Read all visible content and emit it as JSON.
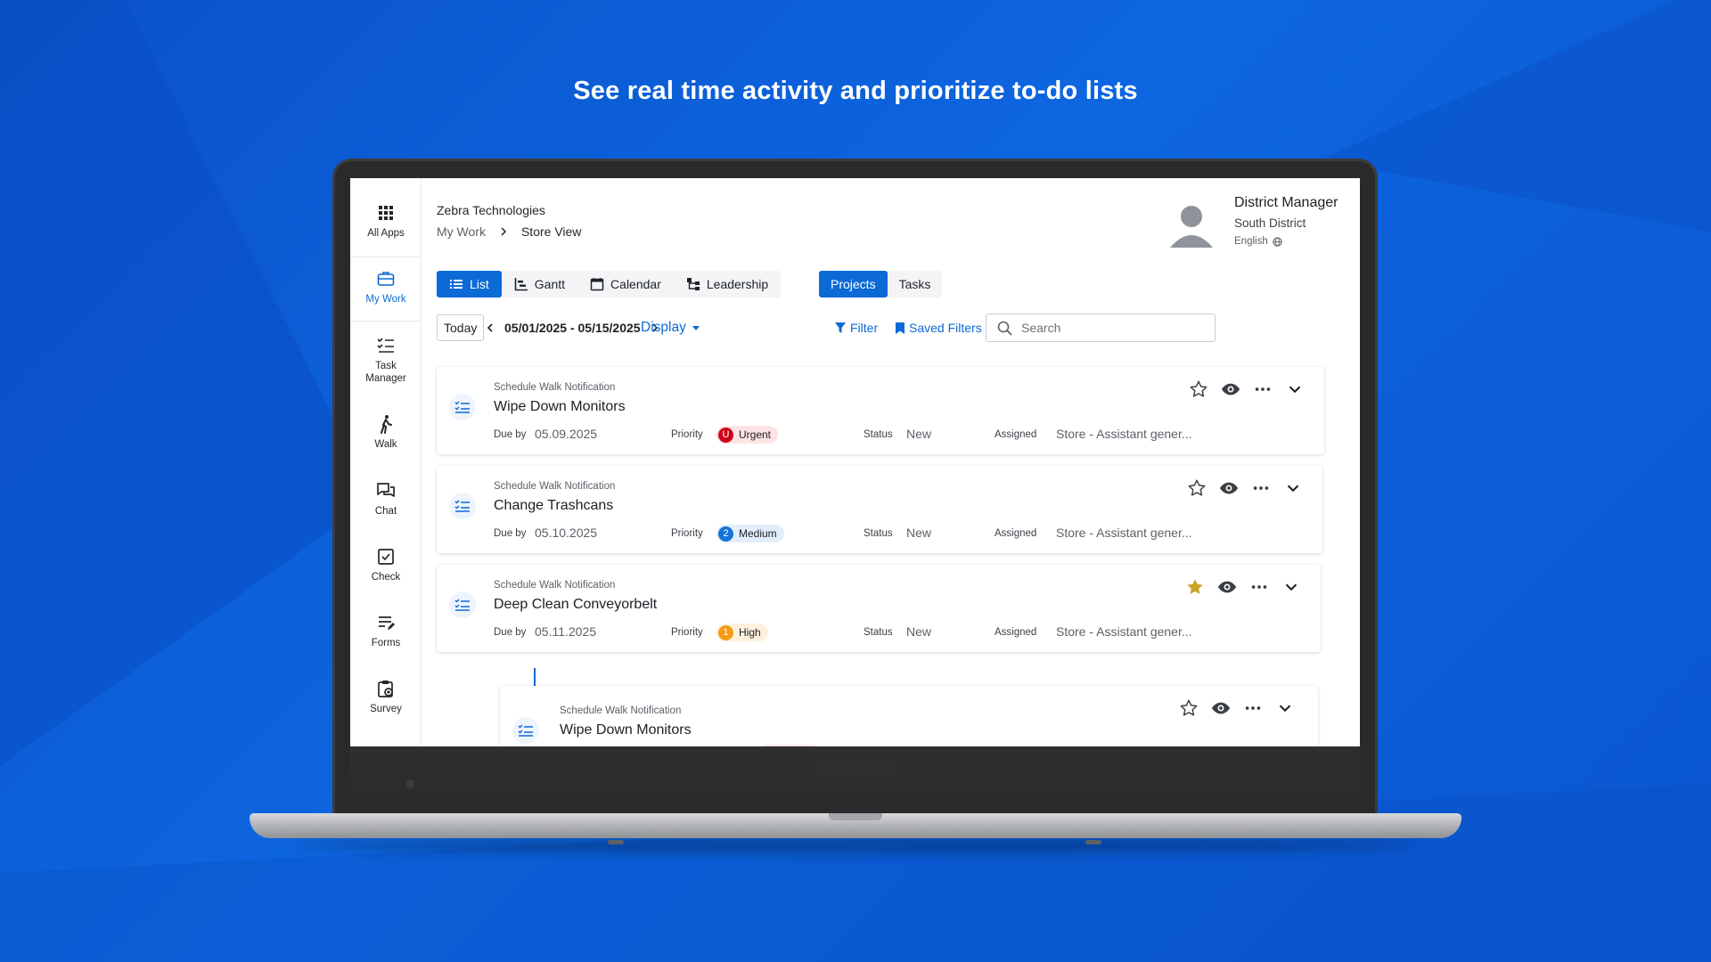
{
  "headline": "See real time activity and prioritize to-do lists",
  "colors": {
    "accent": "#0b6ad6",
    "urgent": "#d0021b",
    "medium": "#1673d8",
    "high": "#f39c12",
    "star_active": "#c9a227"
  },
  "sidebar": {
    "items": [
      {
        "label": "All Apps",
        "icon": "apps-grid-icon"
      },
      {
        "label": "My Work",
        "icon": "briefcase-icon",
        "active": true
      },
      {
        "label": "Task Manager",
        "icon": "task-list-icon"
      },
      {
        "label": "Walk",
        "icon": "walking-person-icon"
      },
      {
        "label": "Chat",
        "icon": "chat-bubbles-icon"
      },
      {
        "label": "Check",
        "icon": "checkbox-icon"
      },
      {
        "label": "Forms",
        "icon": "form-edit-icon"
      },
      {
        "label": "Survey",
        "icon": "survey-clipboard-icon"
      }
    ]
  },
  "header": {
    "company": "Zebra Technologies",
    "breadcrumb": [
      "My Work",
      "Store View"
    ]
  },
  "user": {
    "role": "District Manager",
    "district": "South District",
    "language": "English"
  },
  "view_tabs": [
    "List",
    "Gantt",
    "Calendar",
    "Leadership"
  ],
  "active_view": "List",
  "scope_tabs": [
    "Projects",
    "Tasks"
  ],
  "active_scope": "Projects",
  "toolbar": {
    "today": "Today",
    "date_range": "05/01/2025 - 05/15/2025",
    "display": "Display",
    "filter": "Filter",
    "saved_filters": "Saved Filters",
    "search_placeholder": "Search"
  },
  "labels": {
    "due_by": "Due by",
    "priority": "Priority",
    "status": "Status",
    "assigned": "Assigned"
  },
  "tasks": [
    {
      "type": "Schedule Walk Notification",
      "title": "Wipe Down Monitors",
      "due": "05.09.2025",
      "priority_num": "U",
      "priority": "Urgent",
      "status": "New",
      "assigned": "Store - Assistant gener...",
      "starred": false
    },
    {
      "type": "Schedule Walk Notification",
      "title": "Change Trashcans",
      "due": "05.10.2025",
      "priority_num": "2",
      "priority": "Medium",
      "status": "New",
      "assigned": "Store - Assistant gener...",
      "starred": false
    },
    {
      "type": "Schedule Walk Notification",
      "title": "Deep Clean Conveyorbelt",
      "due": "05.11.2025",
      "priority_num": "1",
      "priority": "High",
      "status": "New",
      "assigned": "Store - Assistant gener...",
      "starred": true
    },
    {
      "type": "Schedule Walk Notification",
      "title": "Wipe Down Monitors",
      "starred": false
    }
  ]
}
